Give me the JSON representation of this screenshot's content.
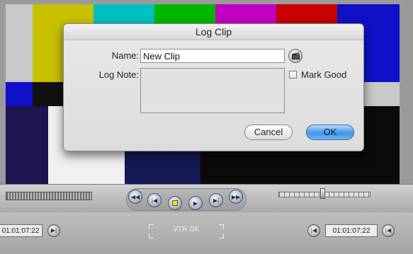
{
  "dialog": {
    "title": "Log Clip",
    "name_label": "Name:",
    "name_value": "New Clip",
    "log_note_label": "Log Note:",
    "log_note_value": "",
    "mark_good_label": "Mark Good",
    "mark_good_checked": false,
    "cancel_label": "Cancel",
    "ok_label": "OK",
    "accent_color": "#3f95e6"
  },
  "transport": {
    "buttons": [
      "rewind-icon",
      "prev-edit-icon",
      "stop-icon",
      "play-icon",
      "next-edit-icon",
      "fast-forward-icon"
    ]
  },
  "status": {
    "left_timecode": "01:01:07:22",
    "vtr_status": "VTR OK",
    "right_timecode": "01:01:07:22"
  },
  "colors": {
    "color_bars": [
      "#c8c8c8",
      "#c8c000",
      "#00c0c0",
      "#00b700",
      "#c000c0",
      "#c80000",
      "#1010c8"
    ]
  }
}
